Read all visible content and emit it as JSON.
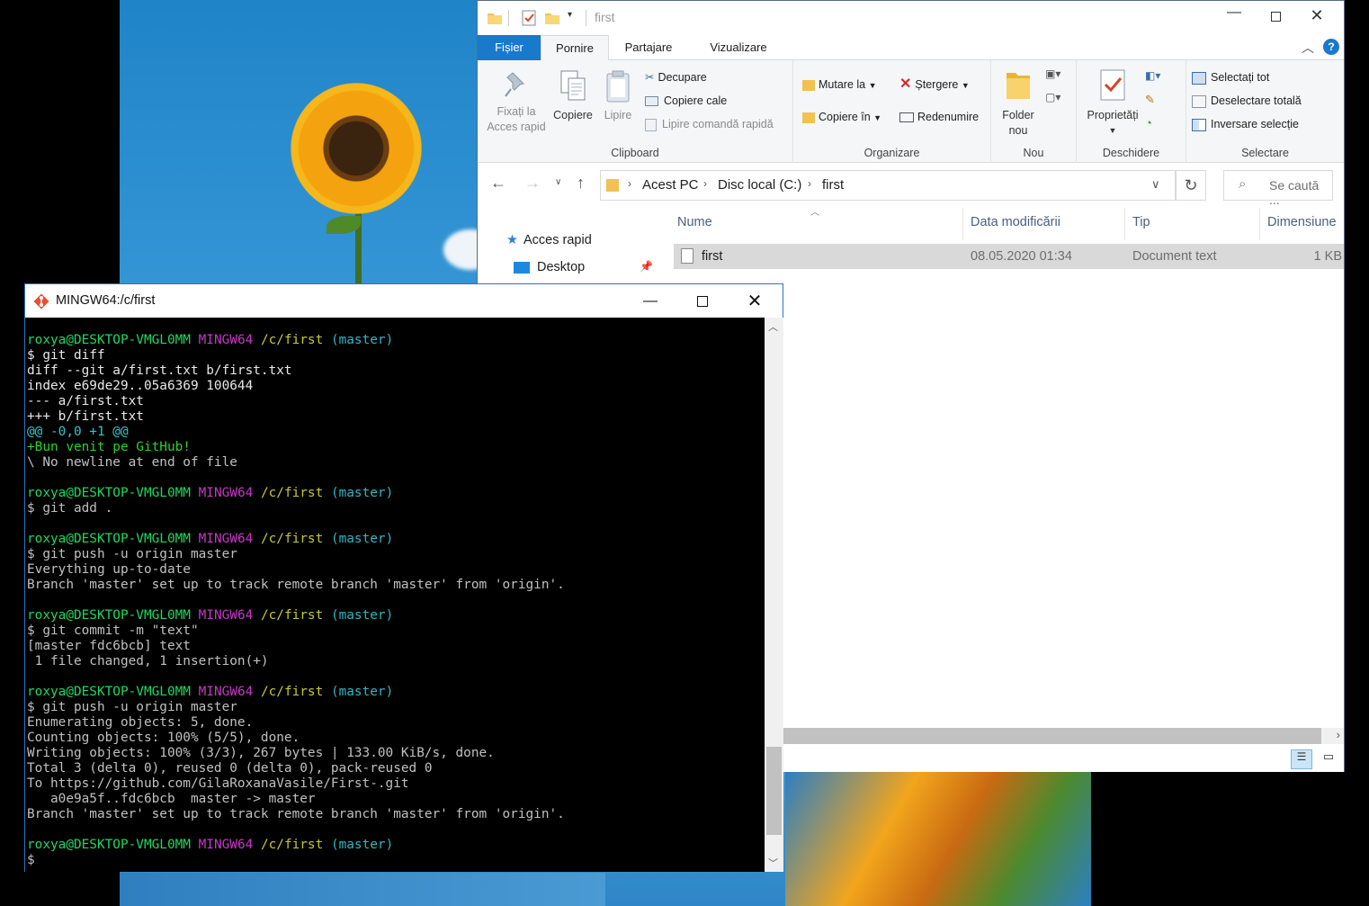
{
  "explorer": {
    "window_title": "first",
    "tabs": [
      "Fișier",
      "Pornire",
      "Partajare",
      "Vizualizare"
    ],
    "ribbon": {
      "clipboard": {
        "group_label": "Clipboard",
        "pin_label_1": "Fixați la",
        "pin_label_2": "Acces rapid",
        "copy_label": "Copiere",
        "paste_label": "Lipire",
        "cut_label": "Decupare",
        "copy_path_label": "Copiere cale",
        "paste_shortcut_label": "Lipire comandă rapidă"
      },
      "organize": {
        "group_label": "Organizare",
        "move_label": "Mutare la",
        "delete_label": "Ștergere",
        "copy_to_label": "Copiere în",
        "rename_label": "Redenumire"
      },
      "new": {
        "group_label": "Nou",
        "folder_label_1": "Folder",
        "folder_label_2": "nou"
      },
      "open": {
        "group_label": "Deschidere",
        "properties_label": "Proprietăți"
      },
      "select": {
        "group_label": "Selectare",
        "select_all": "Selectați tot",
        "select_none": "Deselectare totală",
        "invert": "Inversare selecție"
      }
    },
    "address": {
      "crumbs": [
        "Acest PC",
        "Disc local (C:)",
        "first"
      ],
      "search_placeholder": "Se caută ..."
    },
    "nav": {
      "quick_access": "Acces rapid",
      "desktop": "Desktop"
    },
    "columns": [
      "Nume",
      "Data modificării",
      "Tip",
      "Dimensiune"
    ],
    "files": [
      {
        "name": "first",
        "modified": "08.05.2020 01:34",
        "type": "Document text",
        "size": "1 KB"
      }
    ]
  },
  "terminal": {
    "window_title": "MINGW64:/c/first",
    "prompt": {
      "user": "roxya@DESKTOP-VMGL0MM",
      "env": "MINGW64",
      "path": "/c/first",
      "branch": "(master)"
    },
    "lines": [
      "$ git diff",
      "diff --git a/first.txt b/first.txt",
      "index e69de29..05a6369 100644",
      "--- a/first.txt",
      "+++ b/first.txt",
      "@@ -0,0 +1 @@",
      "+Bun venit pe GitHub!",
      "\\ No newline at end of file",
      "$ git add .",
      "$ git push -u origin master",
      "Everything up-to-date",
      "Branch 'master' set up to track remote branch 'master' from 'origin'.",
      "$ git commit -m \"text\"",
      "[master fdc6bcb] text",
      " 1 file changed, 1 insertion(+)",
      "$ git push -u origin master",
      "Enumerating objects: 5, done.",
      "Counting objects: 100% (5/5), done.",
      "Writing objects: 100% (3/3), 267 bytes | 133.00 KiB/s, done.",
      "Total 3 (delta 0), reused 0 (delta 0), pack-reused 0",
      "To https://github.com/GilaRoxanaVasile/First-.git",
      "   a0e9a5f..fdc6bcb  master -> master",
      "Branch 'master' set up to track remote branch 'master' from 'origin'.",
      "$"
    ],
    "scroll_position": 0.96
  },
  "colors": {
    "accent": "#1979ca",
    "terminal_green": "#1ed760",
    "terminal_magenta": "#c837c8",
    "terminal_yellow": "#c8c837",
    "terminal_cyan": "#33b5c5"
  }
}
